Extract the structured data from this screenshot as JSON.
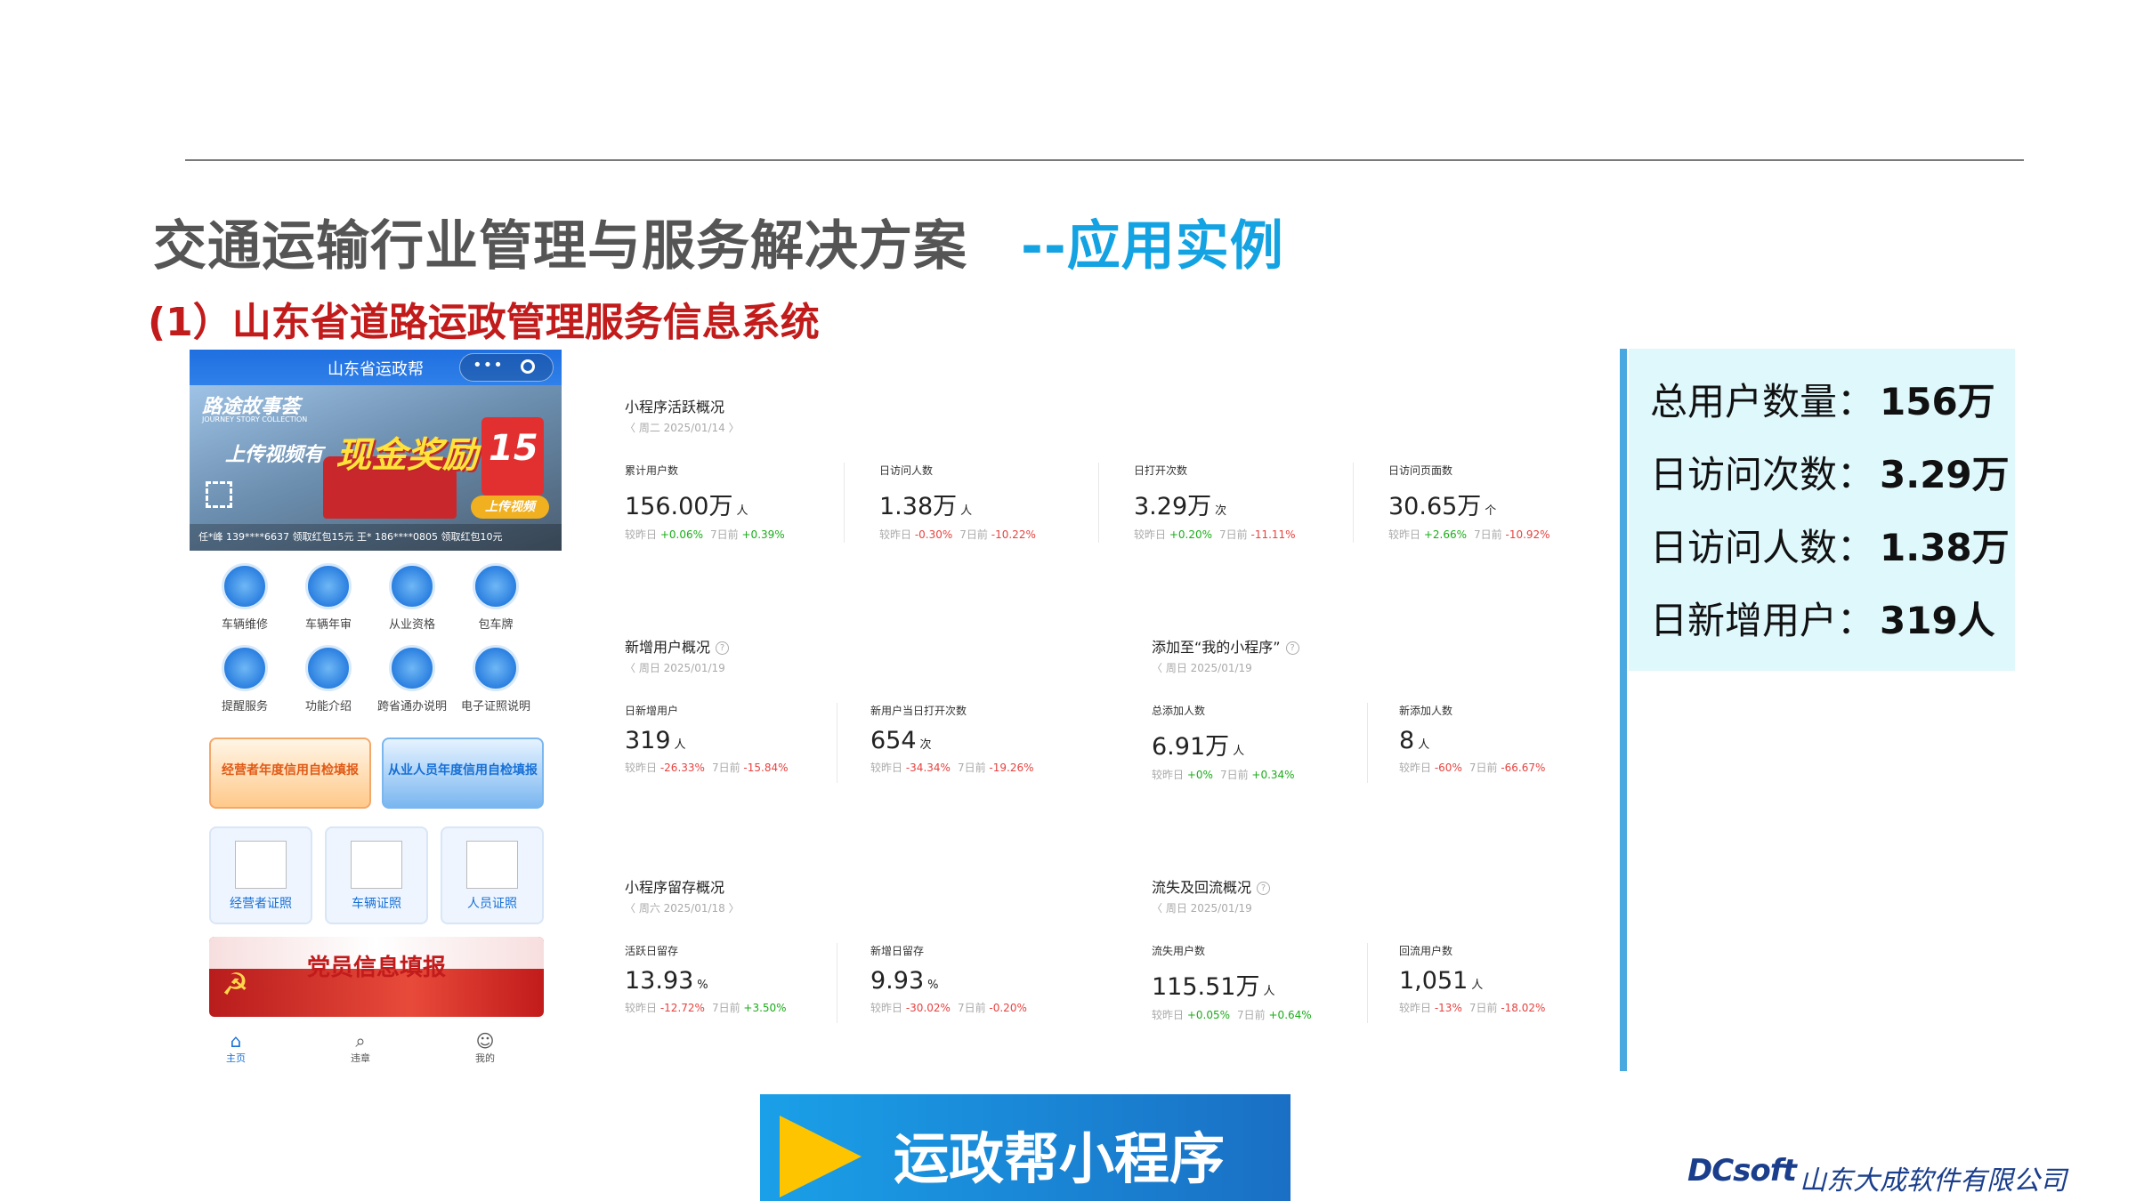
{
  "slide": {
    "title": "交通运输行业管理与服务解决方案",
    "title_accent": "--应用实例",
    "subtitle": "(1）山东省道路运政管理服务信息系统"
  },
  "phone": {
    "app_title": "山东省运政帮",
    "capsule_dots": "•••",
    "banner_title": "路途故事荟",
    "banner_title_en": "JOURNEY STORY COLLECTION",
    "banner_upload_text": "上传视频有",
    "banner_reward": "现金奖励",
    "red_packet_amount": "15",
    "upload_button": "上传视频",
    "ticker": "任*峰 139****6637 领取红包15元    王* 186****0805 领取红包10元",
    "grid_items": [
      {
        "label": "车辆维修"
      },
      {
        "label": "车辆年审"
      },
      {
        "label": "从业资格"
      },
      {
        "label": "包车牌"
      },
      {
        "label": "提醒服务"
      },
      {
        "label": "功能介绍"
      },
      {
        "label": "跨省通办说明"
      },
      {
        "label": "电子证照说明"
      }
    ],
    "promo_a": "经营者年度信用自检填报",
    "promo_b": "从业人员年度信用自检填报",
    "certs": [
      {
        "label": "经营者证照"
      },
      {
        "label": "车辆证照"
      },
      {
        "label": "人员证照"
      }
    ],
    "party_banner": "党员信息填报",
    "party_icon": "☭",
    "tabs": [
      {
        "label": "主页",
        "icon": "⌂"
      },
      {
        "label": "违章",
        "icon": "⌕"
      },
      {
        "label": "我的",
        "icon": "☺"
      }
    ],
    "colors": {
      "accent": "#1770d6",
      "tab_active": "#1770d6"
    }
  },
  "dashboard": {
    "active": {
      "title": "小程序活跃概况",
      "date": "〈   周二 2025/01/14   〉",
      "metrics": [
        {
          "label": "累计用户数",
          "value": "156.00万",
          "unit": "人",
          "d1_label": "较昨日",
          "d1": "+0.06%",
          "d1_color": "g",
          "d7_label": "7日前",
          "d7": "+0.39%",
          "d7_color": "g"
        },
        {
          "label": "日访问人数",
          "value": "1.38万",
          "unit": "人",
          "d1_label": "较昨日",
          "d1": "-0.30%",
          "d1_color": "r",
          "d7_label": "7日前",
          "d7": "-10.22%",
          "d7_color": "r"
        },
        {
          "label": "日打开次数",
          "value": "3.29万",
          "unit": "次",
          "d1_label": "较昨日",
          "d1": "+0.20%",
          "d1_color": "g",
          "d7_label": "7日前",
          "d7": "-11.11%",
          "d7_color": "r"
        },
        {
          "label": "日访问页面数",
          "value": "30.65万",
          "unit": "个",
          "d1_label": "较昨日",
          "d1": "+2.66%",
          "d1_color": "g",
          "d7_label": "7日前",
          "d7": "-10.92%",
          "d7_color": "r"
        }
      ]
    },
    "new_users": {
      "title": "新增用户概况",
      "date": "〈   周日 2025/01/19",
      "metrics": [
        {
          "label": "日新增用户",
          "value": "319",
          "unit": "人",
          "d1_label": "较昨日",
          "d1": "-26.33%",
          "d1_color": "r",
          "d7_label": "7日前",
          "d7": "-15.84%",
          "d7_color": "r"
        },
        {
          "label": "新用户当日打开次数",
          "value": "654",
          "unit": "次",
          "d1_label": "较昨日",
          "d1": "-34.34%",
          "d1_color": "r",
          "d7_label": "7日前",
          "d7": "-19.26%",
          "d7_color": "r"
        }
      ]
    },
    "added": {
      "title": "添加至“我的小程序”",
      "date": "〈   周日 2025/01/19",
      "metrics": [
        {
          "label": "总添加人数",
          "value": "6.91万",
          "unit": "人",
          "d1_label": "较昨日",
          "d1": "+0%",
          "d1_color": "g",
          "d7_label": "7日前",
          "d7": "+0.34%",
          "d7_color": "g"
        },
        {
          "label": "新添加人数",
          "value": "8",
          "unit": "人",
          "d1_label": "较昨日",
          "d1": "-60%",
          "d1_color": "r",
          "d7_label": "7日前",
          "d7": "-66.67%",
          "d7_color": "r"
        }
      ]
    },
    "retention": {
      "title": "小程序留存概况",
      "date": "〈   周六 2025/01/18   〉",
      "metrics": [
        {
          "label": "活跃日留存",
          "value": "13.93",
          "unit": "%",
          "d1_label": "较昨日",
          "d1": "-12.72%",
          "d1_color": "r",
          "d7_label": "7日前",
          "d7": "+3.50%",
          "d7_color": "g"
        },
        {
          "label": "新增日留存",
          "value": "9.93",
          "unit": "%",
          "d1_label": "较昨日",
          "d1": "-30.02%",
          "d1_color": "r",
          "d7_label": "7日前",
          "d7": "-0.20%",
          "d7_color": "r"
        }
      ]
    },
    "churn": {
      "title": "流失及回流概况",
      "date": "〈   周日 2025/01/19",
      "metrics": [
        {
          "label": "流失用户数",
          "value": "115.51万",
          "unit": "人",
          "d1_label": "较昨日",
          "d1": "+0.05%",
          "d1_color": "g",
          "d7_label": "7日前",
          "d7": "+0.64%",
          "d7_color": "g"
        },
        {
          "label": "回流用户数",
          "value": "1,051",
          "unit": "人",
          "d1_label": "较昨日",
          "d1": "-13%",
          "d1_color": "r",
          "d7_label": "7日前",
          "d7": "-18.02%",
          "d7_color": "r"
        }
      ]
    },
    "colors": {
      "up": "#1aad19",
      "down": "#e64340"
    }
  },
  "stats": [
    {
      "label": "总用户数量：",
      "value": "156万"
    },
    {
      "label": "日访问次数：",
      "value": "3.29万"
    },
    {
      "label": "日访问人数：",
      "value": "1.38万"
    },
    {
      "label": "日新增用户：",
      "value": "319人"
    }
  ],
  "cta": {
    "text": "运政帮小程序"
  },
  "footer": {
    "logo": "DCsoft",
    "company": "山东大成软件有限公司"
  }
}
